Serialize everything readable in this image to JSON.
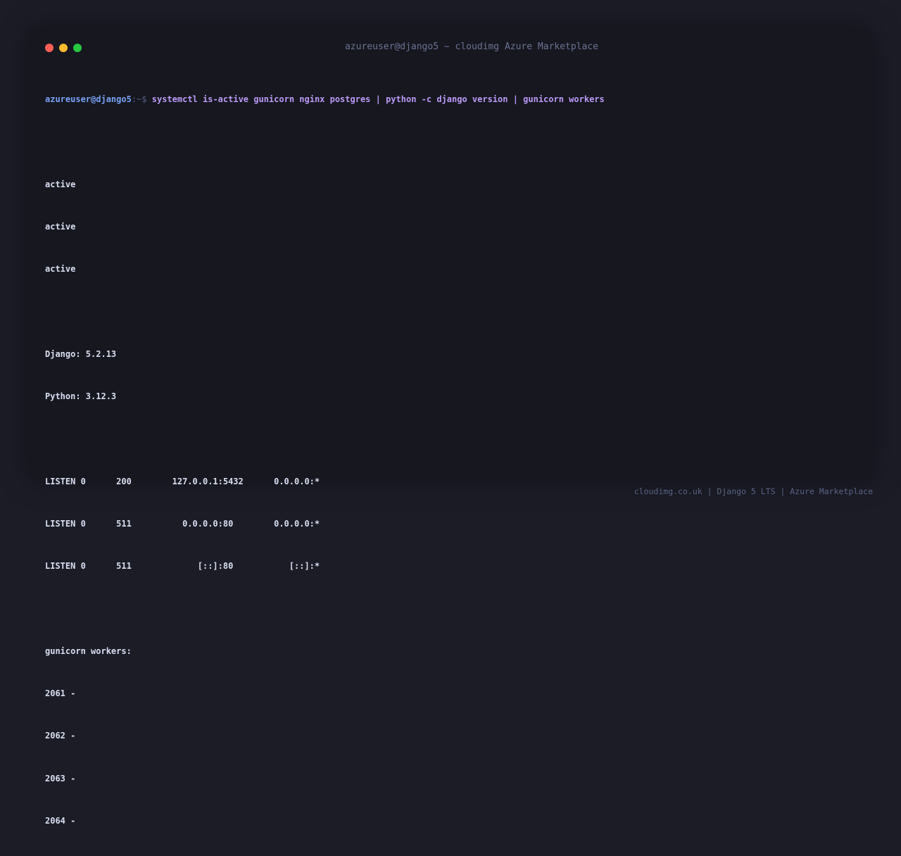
{
  "window": {
    "title": "azureuser@django5 ~ cloudimg Azure Marketplace",
    "controls": {
      "close_color": "#ff5f57",
      "minimize_color": "#febc2e",
      "maximize_color": "#28c840"
    }
  },
  "prompt": {
    "user_host": "azureuser@django5",
    "path": ":~$",
    "command": "systemctl is-active gunicorn nginx postgres | python -c django version | gunicorn workers"
  },
  "output": {
    "service_status": [
      "active",
      "active",
      "active"
    ],
    "versions": [
      "Django: 5.2.13",
      "Python: 3.12.3"
    ],
    "listen_rows": [
      "LISTEN 0      200        127.0.0.1:5432      0.0.0.0:*",
      "LISTEN 0      511          0.0.0.0:80        0.0.0.0:*",
      "LISTEN 0      511             [::]:80           [::]:*"
    ],
    "workers_header": "gunicorn workers:",
    "workers": [
      "2061 -",
      "2062 -",
      "2063 -",
      "2064 -"
    ]
  },
  "footer": "cloudimg.co.uk | Django 5 LTS | Azure Marketplace",
  "colors": {
    "background": "#1b1c26",
    "terminal_bg": "#16171f",
    "prompt_user": "#7aa2f7",
    "command": "#bb9af7",
    "output_text": "#d9dff2"
  }
}
